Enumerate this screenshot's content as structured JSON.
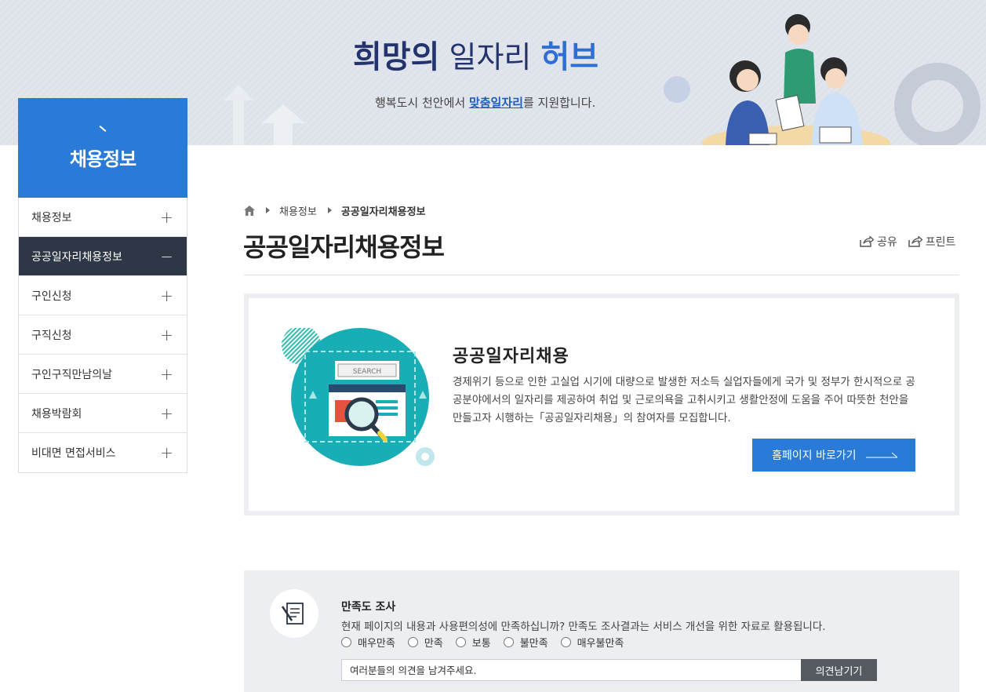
{
  "banner": {
    "slogan_part1": "희망의",
    "slogan_part2": " 일자리 ",
    "slogan_part3": "허브",
    "sub_before": "행복도시 천안에서 ",
    "sub_highlight": "맞춤일자리",
    "sub_after": "를 지원합니다."
  },
  "sidebar": {
    "title": "채용정보",
    "items": [
      {
        "label": "채용정보",
        "state": "+"
      },
      {
        "label": "공공일자리채용정보",
        "state": "−"
      },
      {
        "label": "구인신청",
        "state": "+"
      },
      {
        "label": "구직신청",
        "state": "+"
      },
      {
        "label": "구인구직만남의날",
        "state": "+"
      },
      {
        "label": "채용박람회",
        "state": "+"
      },
      {
        "label": "비대면 면접서비스",
        "state": "+"
      }
    ]
  },
  "breadcrumb": {
    "level1": "채용정보",
    "level2": "공공일자리채용정보"
  },
  "page": {
    "title": "공공일자리채용정보",
    "share_label": "공유",
    "print_label": "프린트"
  },
  "card": {
    "title": "공공일자리채용",
    "description": "경제위기 등으로 인한 고실업 시기에 대량으로 발생한 저소득 실업자들에게 국가 및 정부가 한시적으로 공공분야에서의 일자리를 제공하여 취업 및 근로의욕을 고취시키고 생활안정에 도움을 주어 따뜻한 천안을 만들고자 시행하는「공공일자리채용」의 참여자를 모집합니다.",
    "button_label": "홈페이지 바로가기",
    "search_label": "SEARCH"
  },
  "survey": {
    "title": "만족도 조사",
    "description": "현재 페이지의 내용과 사용편의성에 만족하십니까? 만족도 조사결과는 서비스 개선을 위한 자료로 활용됩니다.",
    "options": [
      "매우만족",
      "만족",
      "보통",
      "불만족",
      "매우불만족"
    ],
    "input_placeholder": "여러분들의 의견을 남겨주세요.",
    "submit_label": "의견남기기"
  },
  "colors": {
    "primary": "#2a7ad7",
    "active_menu": "#2d3746",
    "banner_bg": "#dee2ea"
  }
}
